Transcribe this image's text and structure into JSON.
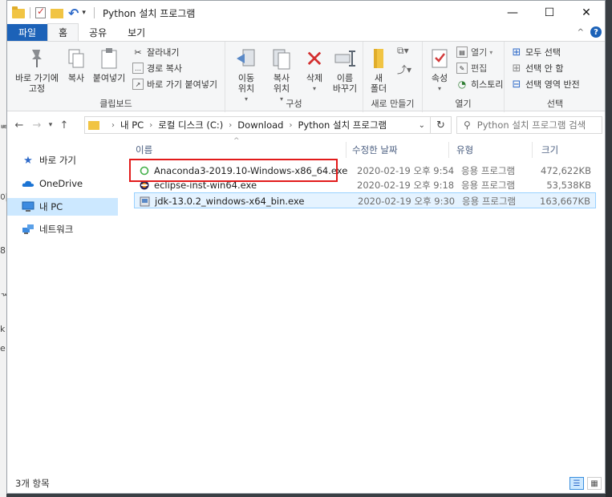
{
  "titlebar": {
    "title": "Python 설치 프로그램",
    "qa_dropdown": "▾",
    "controls": {
      "minimize": "—",
      "maximize": "☐",
      "close": "✕"
    }
  },
  "tabs": {
    "file": "파일",
    "items": [
      "홈",
      "공유",
      "보기"
    ],
    "active": "홈"
  },
  "ribbon": {
    "clipboard": {
      "label": "클립보드",
      "pin": "바로 가기에\n고정",
      "copy": "복사",
      "paste": "붙여넣기",
      "cut": "잘라내기",
      "copy_path": "경로 복사",
      "paste_shortcut": "바로 가기 붙여넣기"
    },
    "organize": {
      "label": "구성",
      "move_to": "이동\n위치",
      "copy_to": "복사\n위치",
      "delete": "삭제",
      "rename": "이름\n바꾸기"
    },
    "new": {
      "label": "새로 만들기",
      "new_folder": "새\n폴더"
    },
    "open": {
      "label": "열기",
      "properties": "속성",
      "open": "열기",
      "edit": "편집",
      "history": "히스토리"
    },
    "select": {
      "label": "선택",
      "select_all": "모두 선택",
      "select_none": "선택 안 함",
      "invert": "선택 영역 반전"
    }
  },
  "addressbar": {
    "crumbs": [
      "내 PC",
      "로컬 디스크 (C:)",
      "Download",
      "Python 설치 프로그램"
    ],
    "search_placeholder": "Python 설치 프로그램 검색"
  },
  "navpane": {
    "items": [
      {
        "label": "바로 가기",
        "icon": "star-icon",
        "selected": false
      },
      {
        "label": "OneDrive",
        "icon": "cloud-icon",
        "selected": false
      },
      {
        "label": "내 PC",
        "icon": "computer-icon",
        "selected": true
      },
      {
        "label": "네트워크",
        "icon": "network-icon",
        "selected": false
      }
    ]
  },
  "filelist": {
    "columns": {
      "name": "이름",
      "date": "수정한 날짜",
      "type": "유형",
      "size": "크기"
    },
    "rows": [
      {
        "name": "Anaconda3-2019.10-Windows-x86_64.exe",
        "date": "2020-02-19 오후 9:54",
        "type": "응용 프로그램",
        "size": "472,622KB",
        "icon": "anaconda-icon"
      },
      {
        "name": "eclipse-inst-win64.exe",
        "date": "2020-02-19 오후 9:18",
        "type": "응용 프로그램",
        "size": "53,538KB",
        "icon": "eclipse-icon"
      },
      {
        "name": "jdk-13.0.2_windows-x64_bin.exe",
        "date": "2020-02-19 오후 9:30",
        "type": "응용 프로그램",
        "size": "163,667KB",
        "icon": "installer-icon"
      }
    ],
    "selected_row": 2
  },
  "statusbar": {
    "count": "3개 항목"
  },
  "colors": {
    "accent": "#1c62b8",
    "highlight": "#e21b1b",
    "selection": "#cce8ff"
  }
}
